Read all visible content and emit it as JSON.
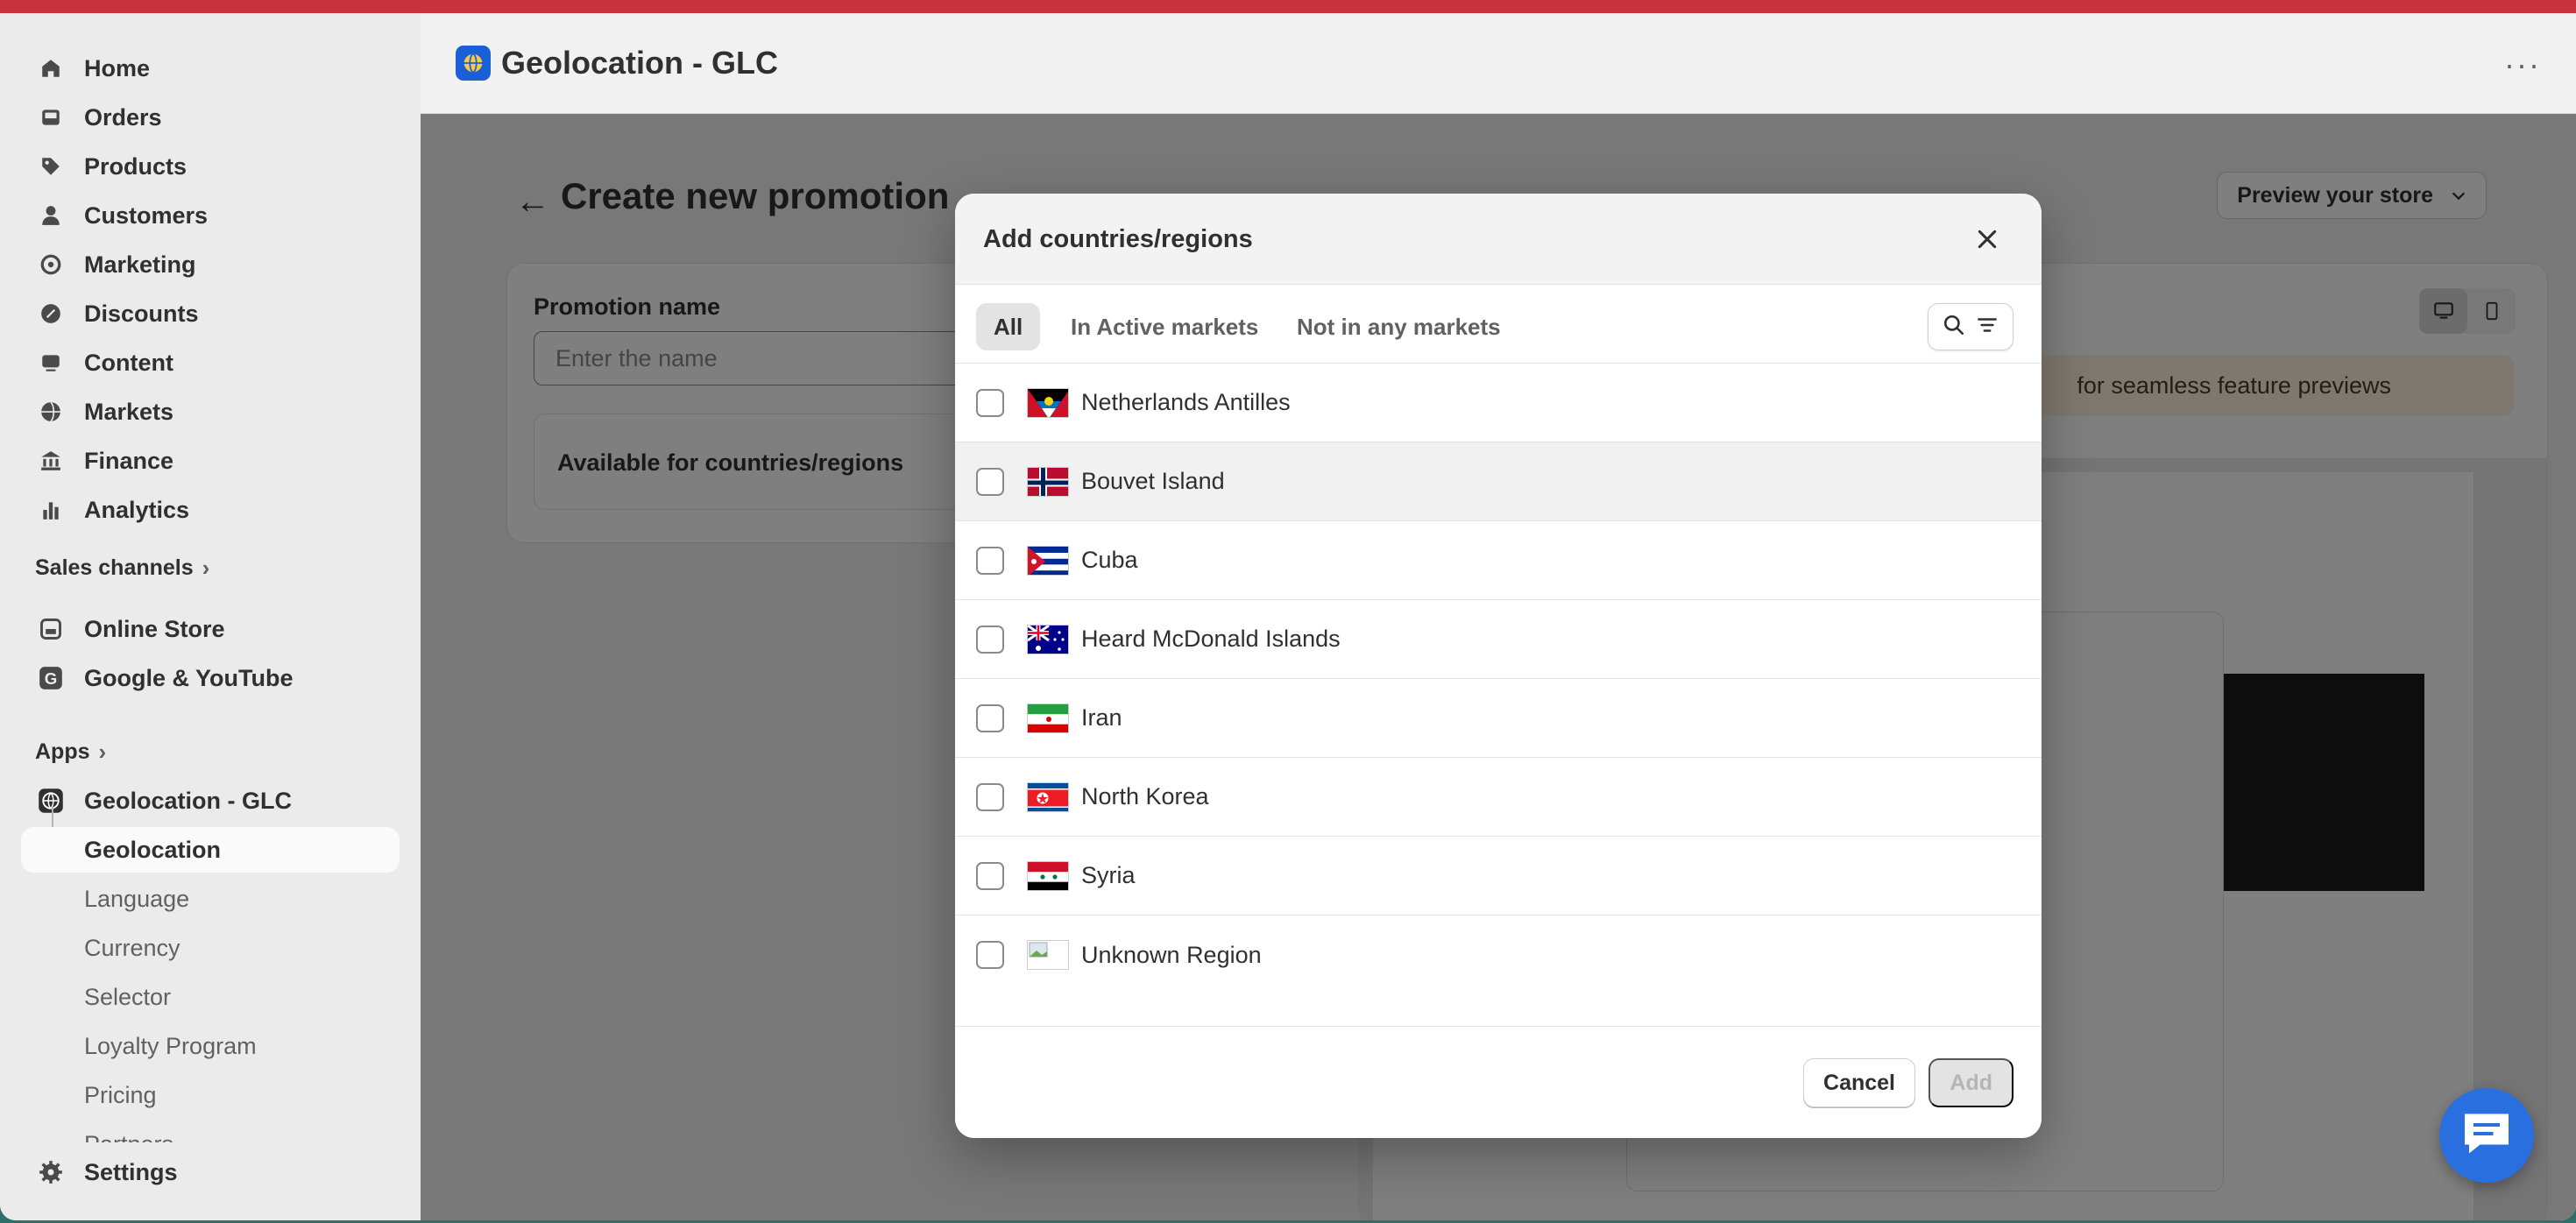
{
  "sidebar": {
    "main_items": [
      {
        "label": "Home",
        "icon": "home-icon"
      },
      {
        "label": "Orders",
        "icon": "inbox-icon"
      },
      {
        "label": "Products",
        "icon": "tag-icon"
      },
      {
        "label": "Customers",
        "icon": "person-icon"
      },
      {
        "label": "Marketing",
        "icon": "target-icon"
      },
      {
        "label": "Discounts",
        "icon": "discount-icon"
      },
      {
        "label": "Content",
        "icon": "content-icon"
      },
      {
        "label": "Markets",
        "icon": "globe-icon"
      },
      {
        "label": "Finance",
        "icon": "bank-icon"
      },
      {
        "label": "Analytics",
        "icon": "bar-chart-icon"
      }
    ],
    "sales_channels_label": "Sales channels",
    "channels": [
      {
        "label": "Online Store",
        "icon": "store-icon"
      },
      {
        "label": "Google & YouTube",
        "icon": "google-icon"
      }
    ],
    "apps_label": "Apps",
    "app": {
      "label": "Geolocation - GLC"
    },
    "app_subitems": [
      "Geolocation",
      "Language",
      "Currency",
      "Selector",
      "Loyalty Program",
      "Pricing",
      "Partners"
    ],
    "settings_label": "Settings"
  },
  "header": {
    "app_title": "Geolocation - GLC",
    "more": "···"
  },
  "page": {
    "title": "Create new promotion",
    "preview_button": "Preview your store",
    "promotion_name_label": "Promotion name",
    "promotion_name_placeholder": "Enter the name",
    "available_label": "Available for countries/regions",
    "banner_text": "for seamless feature previews"
  },
  "modal": {
    "title": "Add countries/regions",
    "tabs": [
      "All",
      "In Active markets",
      "Not in any markets"
    ],
    "selected_tab": "All",
    "countries": [
      {
        "name": "Netherlands Antilles",
        "flag": "antigua-flag"
      },
      {
        "name": "Bouvet Island",
        "flag": "norway-flag"
      },
      {
        "name": "Cuba",
        "flag": "cuba-flag"
      },
      {
        "name": "Heard McDonald Islands",
        "flag": "australia-flag"
      },
      {
        "name": "Iran",
        "flag": "iran-flag"
      },
      {
        "name": "North Korea",
        "flag": "north-korea-flag"
      },
      {
        "name": "Syria",
        "flag": "syria-flag"
      },
      {
        "name": "Unknown Region",
        "flag": "broken-image"
      }
    ],
    "cancel_label": "Cancel",
    "add_label": "Add"
  },
  "colors": {
    "accent_red": "#c8323a",
    "chat_blue": "#2a6fe0"
  }
}
